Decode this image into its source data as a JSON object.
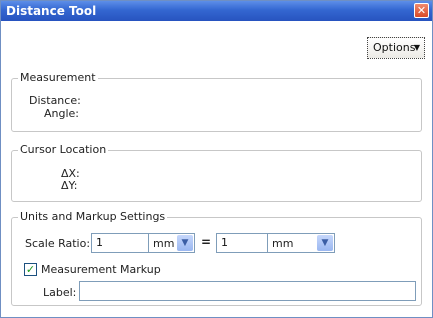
{
  "window": {
    "title": "Distance Tool",
    "close_glyph": "✕"
  },
  "toolbar": {
    "options_label": "Options",
    "options_arrow": "▼"
  },
  "measurement": {
    "legend": "Measurement",
    "distance_label": "Distance:",
    "angle_label": "Angle:"
  },
  "cursor": {
    "legend": "Cursor Location",
    "dx_label": "ΔX:",
    "dy_label": "ΔY:"
  },
  "units": {
    "legend": "Units and Markup Settings",
    "scale_ratio_label": "Scale Ratio:",
    "left_value": "1",
    "left_unit": "mm",
    "equals": "=",
    "right_value": "1",
    "right_unit": "mm",
    "dropdown_glyph": "▼",
    "markup_checked": true,
    "check_glyph": "✓",
    "markup_label": "Measurement Markup",
    "label_label": "Label:",
    "label_value": ""
  }
}
